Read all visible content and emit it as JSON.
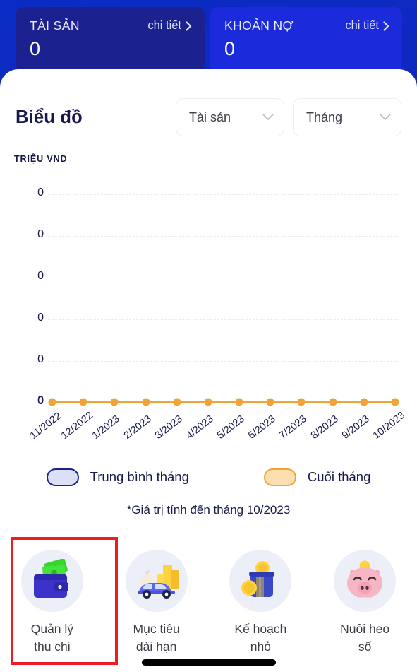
{
  "summary_cards": [
    {
      "name": "assets",
      "label": "TÀI SẢN",
      "detail_label": "chi tiết",
      "value": "0",
      "color": "#1c2190"
    },
    {
      "name": "liabilities",
      "label": "KHOẢN NỢ",
      "detail_label": "chi tiết",
      "value": "0",
      "color": "#1b2bdb"
    }
  ],
  "chart_section": {
    "title": "Biểu đồ",
    "filters": [
      {
        "name": "metric",
        "value": "Tài sản",
        "icon": "chevron-down-icon"
      },
      {
        "name": "period",
        "value": "Tháng",
        "icon": "chevron-down-icon"
      }
    ],
    "axis_unit": "TRIỆU VND",
    "footnote": "*Giá trị tính đến tháng 10/2023",
    "legend": [
      {
        "name": "monthly-average",
        "label": "Trung bình tháng",
        "fill": "#dcdff5",
        "border": "#1c2190"
      },
      {
        "name": "month-end",
        "label": "Cuối tháng",
        "fill": "#fbdfb0",
        "border": "#f0a336"
      }
    ]
  },
  "chart_data": {
    "type": "line",
    "title": "Biểu đồ",
    "xlabel": "",
    "ylabel": "TRIỆU VND",
    "ylim": [
      0,
      0
    ],
    "grid": true,
    "legend_position": "bottom",
    "categories": [
      "11/2022",
      "12/2022",
      "1/2023",
      "2/2023",
      "3/2023",
      "4/2023",
      "5/2023",
      "6/2023",
      "7/2023",
      "8/2023",
      "9/2023",
      "10/2023"
    ],
    "ytick_labels": [
      "0",
      "0",
      "0",
      "0",
      "0",
      "0"
    ],
    "series": [
      {
        "name": "Cuối tháng",
        "color": "#f0a336",
        "values": [
          0,
          0,
          0,
          0,
          0,
          0,
          0,
          0,
          0,
          0,
          0,
          0
        ]
      }
    ],
    "annotations": [
      "*Giá trị tính đến tháng 10/2023"
    ]
  },
  "shortcuts": [
    {
      "name": "expense-management",
      "label": "Quản lý\nthu chi",
      "icon": "wallet-cash-icon",
      "highlighted": true
    },
    {
      "name": "long-term-goal",
      "label": "Mục tiêu\ndài hạn",
      "icon": "car-coins-icon",
      "highlighted": false
    },
    {
      "name": "small-plan",
      "label": "Kế hoạch\nnhỏ",
      "icon": "coin-jar-icon",
      "highlighted": false
    },
    {
      "name": "digital-piggy-bank",
      "label": "Nuôi heo\nsố",
      "icon": "piggy-bank-icon",
      "highlighted": false
    }
  ],
  "highlight_color": "#ee1c22"
}
